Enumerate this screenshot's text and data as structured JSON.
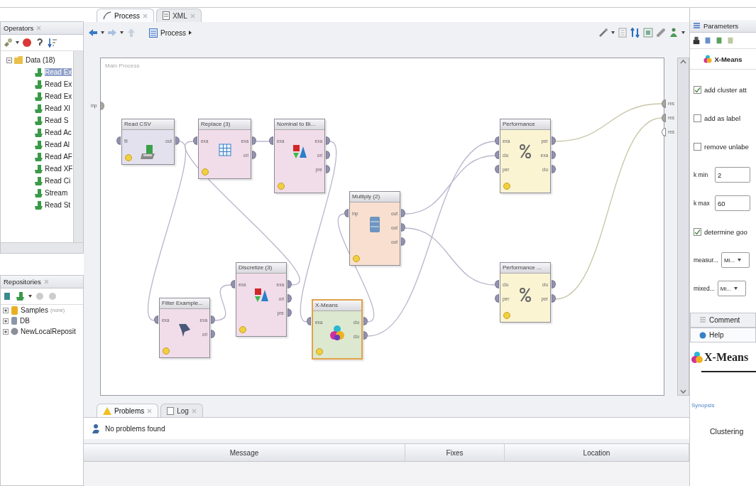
{
  "editor_tabs": [
    {
      "label": "Process",
      "selected": true
    },
    {
      "label": "XML",
      "selected": false
    }
  ],
  "operators_panel": {
    "title": "Operators",
    "tree": [
      {
        "label": "Data (18)",
        "expanded": true,
        "children": [
          {
            "label": "Read Ex",
            "selected": true
          },
          {
            "label": "Read Ex",
            "selected": false
          },
          {
            "label": "Read Ex",
            "selected": false
          },
          {
            "label": "Read XI",
            "selected": false
          },
          {
            "label": "Read S",
            "selected": false
          },
          {
            "label": "Read Ac",
            "selected": false
          },
          {
            "label": "Read Al",
            "selected": false
          },
          {
            "label": "Read AF",
            "selected": false
          },
          {
            "label": "Read XF",
            "selected": false
          },
          {
            "label": "Read Ci",
            "selected": false
          },
          {
            "label": "Stream",
            "selected": false
          },
          {
            "label": "Read St",
            "selected": false
          }
        ]
      }
    ]
  },
  "repositories_panel": {
    "title": "Repositories",
    "items": [
      {
        "label": "Samples",
        "note": "(none)"
      },
      {
        "label": "DB"
      },
      {
        "label": "NewLocalReposit"
      }
    ]
  },
  "breadcrumb": "Process",
  "process": {
    "title": "Main Process",
    "inputs": [
      "inp"
    ],
    "outputs": [
      "res",
      "res",
      "res"
    ]
  },
  "operators": [
    {
      "title": "Read CSV",
      "color": "#e4e1ef",
      "selected": false,
      "inputs": [
        "fil"
      ],
      "outputs": [
        "out"
      ]
    },
    {
      "title": "Replace (3)",
      "color": "#f1dcea",
      "selected": false,
      "inputs": [
        "exa"
      ],
      "outputs": [
        "exa",
        "ori"
      ]
    },
    {
      "title": "Nominal to Bi...",
      "color": "#f1dcea",
      "selected": false,
      "inputs": [
        "exa"
      ],
      "outputs": [
        "exa",
        "ori",
        "pre"
      ]
    },
    {
      "title": "Multiply (2)",
      "color": "#f9dfcf",
      "selected": false,
      "inputs": [
        "inp"
      ],
      "outputs": [
        "out",
        "out",
        "out"
      ]
    },
    {
      "title": "Performance",
      "color": "#fbf4d3",
      "selected": false,
      "inputs": [
        "exa",
        "clu",
        "per"
      ],
      "outputs": [
        "per",
        "exa",
        "clu"
      ]
    },
    {
      "title": "Filter Example...",
      "color": "#f1dcea",
      "selected": false,
      "inputs": [
        "exa"
      ],
      "outputs": [
        "exa",
        "ori"
      ]
    },
    {
      "title": "Discretize (3)",
      "color": "#f1dcea",
      "selected": false,
      "inputs": [
        "exa"
      ],
      "outputs": [
        "exa",
        "ori",
        "pre"
      ]
    },
    {
      "title": "X-Means",
      "color": "#dce8d0",
      "selected": true,
      "inputs": [
        "exa"
      ],
      "outputs": [
        "clu",
        "clu"
      ]
    },
    {
      "title": "Performance ...",
      "color": "#fbf4d3",
      "selected": false,
      "inputs": [
        "clu",
        "per"
      ],
      "outputs": [
        "clu",
        "per"
      ]
    }
  ],
  "bottom_tabs": [
    {
      "label": "Problems",
      "selected": true
    },
    {
      "label": "Log",
      "selected": false
    }
  ],
  "problems": {
    "status": "No problems found",
    "columns": [
      "Message",
      "Fixes",
      "Location"
    ]
  },
  "parameters_panel": {
    "title": "Parameters",
    "operator": "X-Means",
    "params": [
      {
        "kind": "checkbox",
        "label": "add cluster att",
        "checked": true
      },
      {
        "kind": "checkbox",
        "label": "add as label",
        "checked": false
      },
      {
        "kind": "checkbox",
        "label": "remove unlabe",
        "checked": false
      },
      {
        "kind": "text",
        "label": "k min",
        "value": "2"
      },
      {
        "kind": "text",
        "label": "k max",
        "value": "60"
      },
      {
        "kind": "checkbox",
        "label": "determine goo",
        "checked": true
      },
      {
        "kind": "dropdown",
        "label": "measur...",
        "value": "Mi..."
      },
      {
        "kind": "dropdown",
        "label": "mixed...",
        "value": "Mi..."
      }
    ]
  },
  "side_tabs": [
    {
      "label": "Comment",
      "selected": false
    },
    {
      "label": "Help",
      "selected": true
    }
  ],
  "help": {
    "title": "X-Means",
    "section": "Synopsis",
    "text": "Clustering"
  }
}
